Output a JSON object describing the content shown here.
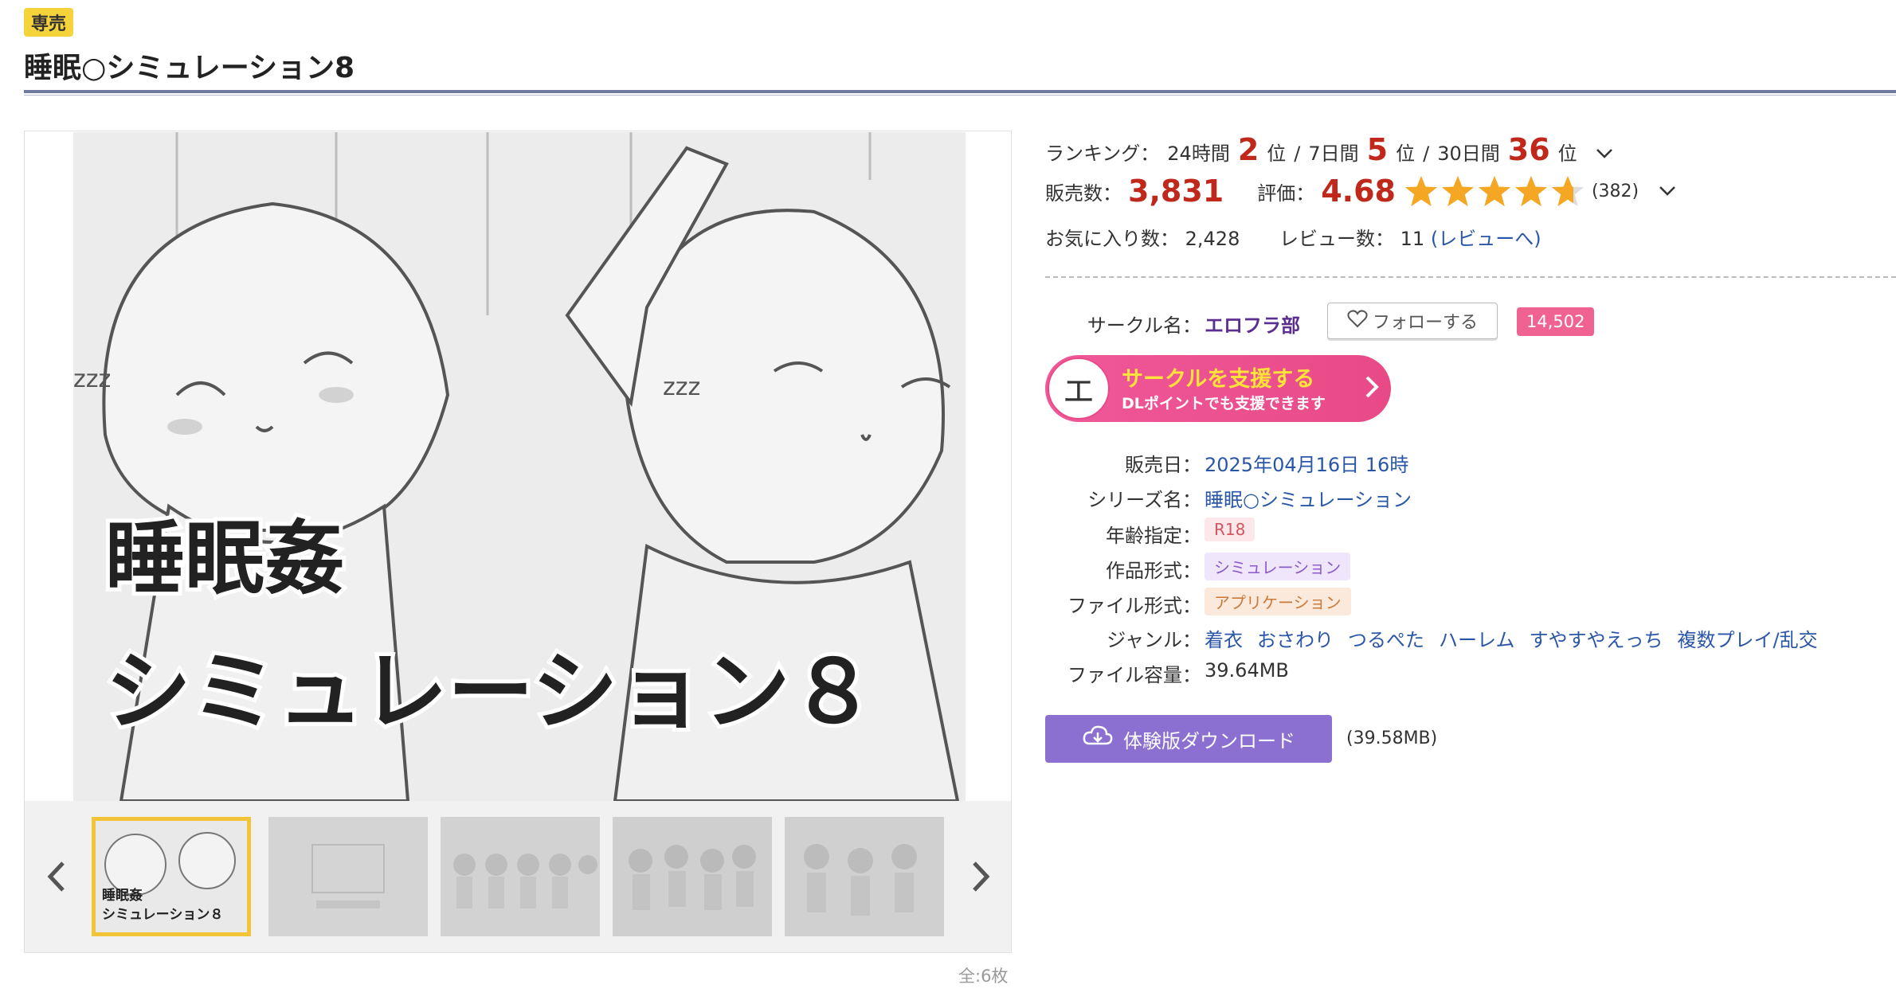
{
  "header": {
    "badge": "専売",
    "title": "睡眠○シミュレーション8"
  },
  "gallery": {
    "main_title_line1": "睡眠姦",
    "main_title_line2": "シミュレーション８",
    "thumb_title_line1": "睡眠姦",
    "thumb_title_line2": "シミュレーション８",
    "count": "全:6枚"
  },
  "ranking": {
    "label": "ランキング：",
    "d24_label": "24時間",
    "d24_rank": "2",
    "unit": "位",
    "d7_label": "7日間",
    "d7_rank": "5",
    "d30_label": "30日間",
    "d30_rank": "36",
    "sep": "/"
  },
  "sales": {
    "label": "販売数：",
    "value": "3,831"
  },
  "rating": {
    "label": "評価：",
    "value": "4.68",
    "stars": 4.68,
    "count": "(382)"
  },
  "favorites": {
    "label": "お気に入り数：",
    "value": "2,428"
  },
  "reviews": {
    "label": "レビュー数：",
    "value": "11",
    "link": "(レビューへ)"
  },
  "circle": {
    "label": "サークル名：",
    "name": "エロフラ部",
    "follow_label": "フォローする",
    "follower_count": "14,502"
  },
  "support": {
    "icon_char": "エ",
    "title": "サークルを支援する",
    "subtitle": "DLポイントでも支援できます"
  },
  "details": {
    "release_label": "販売日：",
    "release_value": "2025年04月16日 16時",
    "series_label": "シリーズ名：",
    "series_value": "睡眠○シミュレーション",
    "age_label": "年齢指定：",
    "age_value": "R18",
    "format_label": "作品形式：",
    "format_value": "シミュレーション",
    "file_label": "ファイル形式：",
    "file_value": "アプリケーション",
    "genre_label": "ジャンル：",
    "genres": [
      "着衣",
      "おさわり",
      "つるぺた",
      "ハーレム",
      "すやすやえっち",
      "複数プレイ/乱交"
    ],
    "size_label": "ファイル容量：",
    "size_value": "39.64MB"
  },
  "download": {
    "label": "体験版ダウンロード",
    "size": "(39.58MB)"
  },
  "colors": {
    "accent_red": "#c0281c",
    "link_blue": "#2a56a7",
    "star": "#f5a623",
    "pink": "#e84a86",
    "purple": "#8b6fd1"
  }
}
